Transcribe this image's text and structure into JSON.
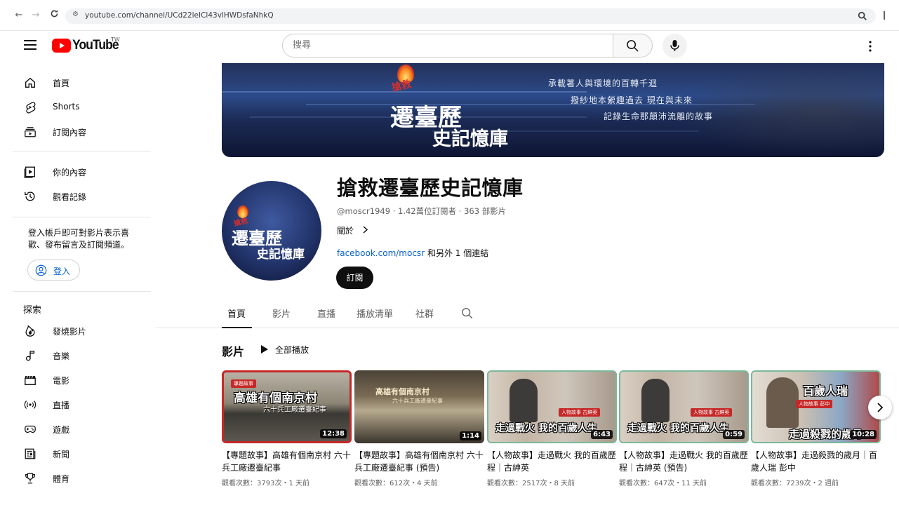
{
  "browser": {
    "url": "youtube.com/channel/UCd22leICl43vlHWDsfaNhkQ"
  },
  "masthead": {
    "logo_text": "YouTube",
    "region": "TW",
    "search_placeholder": "搜尋"
  },
  "sidebar": {
    "primary": [
      {
        "label": "首頁",
        "icon": "home-icon"
      },
      {
        "label": "Shorts",
        "icon": "shorts-icon"
      },
      {
        "label": "訂閱內容",
        "icon": "subscriptions-icon"
      }
    ],
    "you": [
      {
        "label": "你的內容",
        "icon": "your-channel-icon"
      },
      {
        "label": "觀看記錄",
        "icon": "history-icon"
      }
    ],
    "signin_prompt": "登入帳戶即可對影片表示喜歡、發布留言及訂閱頻道。",
    "signin_label": "登入",
    "explore_title": "探索",
    "explore": [
      {
        "label": "發燒影片",
        "icon": "trending-icon"
      },
      {
        "label": "音樂",
        "icon": "music-icon"
      },
      {
        "label": "電影",
        "icon": "movies-icon"
      },
      {
        "label": "直播",
        "icon": "live-icon"
      },
      {
        "label": "遊戲",
        "icon": "gaming-icon"
      },
      {
        "label": "新聞",
        "icon": "news-icon"
      },
      {
        "label": "體育",
        "icon": "sports-icon"
      }
    ]
  },
  "banner": {
    "tag": "搶救",
    "title_line1": "遷臺歷",
    "title_line2": "史記憶庫",
    "line1": "承載著人與環境的百轉千迴",
    "line2": "撥紗地本縈趣過去 現在與未來",
    "line3": "記錄生命那顛沛流離的故事"
  },
  "channel": {
    "name": "搶救遷臺歷史記憶庫",
    "meta": "@moscr1949 · 1.42萬位訂閱者 · 363 部影片",
    "about": "關於",
    "link": "facebook.com/mocsr",
    "link_more": "和另外 1 個連結",
    "subscribe": "訂閱"
  },
  "tabs": [
    {
      "label": "首頁",
      "active": true
    },
    {
      "label": "影片",
      "active": false
    },
    {
      "label": "直播",
      "active": false
    },
    {
      "label": "播放清單",
      "active": false
    },
    {
      "label": "社群",
      "active": false
    }
  ],
  "shelf": {
    "title": "影片",
    "play_all": "全部播放"
  },
  "videos": [
    {
      "title": "【專題故事】高雄有個南京村 六十兵工廠遷臺紀事",
      "meta": "觀看次數：3793次・1 天前",
      "duration": "12:38",
      "caption": "高雄有個南京村",
      "sub": "六十兵工廠遷臺紀事",
      "tag": "專題故事"
    },
    {
      "title": "【專題故事】高雄有個南京村 六十兵工廠遷臺紀事 (預告)",
      "meta": "觀看次數：612次・4 天前",
      "duration": "1:14",
      "caption": "高雄有個南京村",
      "sub": "六十兵工廠遷臺紀事",
      "tag": ""
    },
    {
      "title": "【人物故事】走過戰火 我的百歲歷程｜古紳英",
      "meta": "觀看次數：2517次・8 天前",
      "duration": "6:43",
      "caption": "走過戰火 我的百歲人生",
      "sub": "",
      "tag": "人物故事 古紳英"
    },
    {
      "title": "【人物故事】走過戰火 我的百歲歷程｜古紳英 (預告)",
      "meta": "觀看次數：647次・11 天前",
      "duration": "0:59",
      "caption": "走過戰火 我的百歲人生",
      "sub": "",
      "tag": "人物故事 古紳英"
    },
    {
      "title": "【人物故事】走過殺戮的歲月｜百歲人瑞 彭中",
      "meta": "觀看次數：7239次・2 週前",
      "duration": "10:28",
      "caption": "百歲人瑞",
      "sub": "走過殺戮的歲月",
      "tag": "人物故事 彭中"
    }
  ]
}
